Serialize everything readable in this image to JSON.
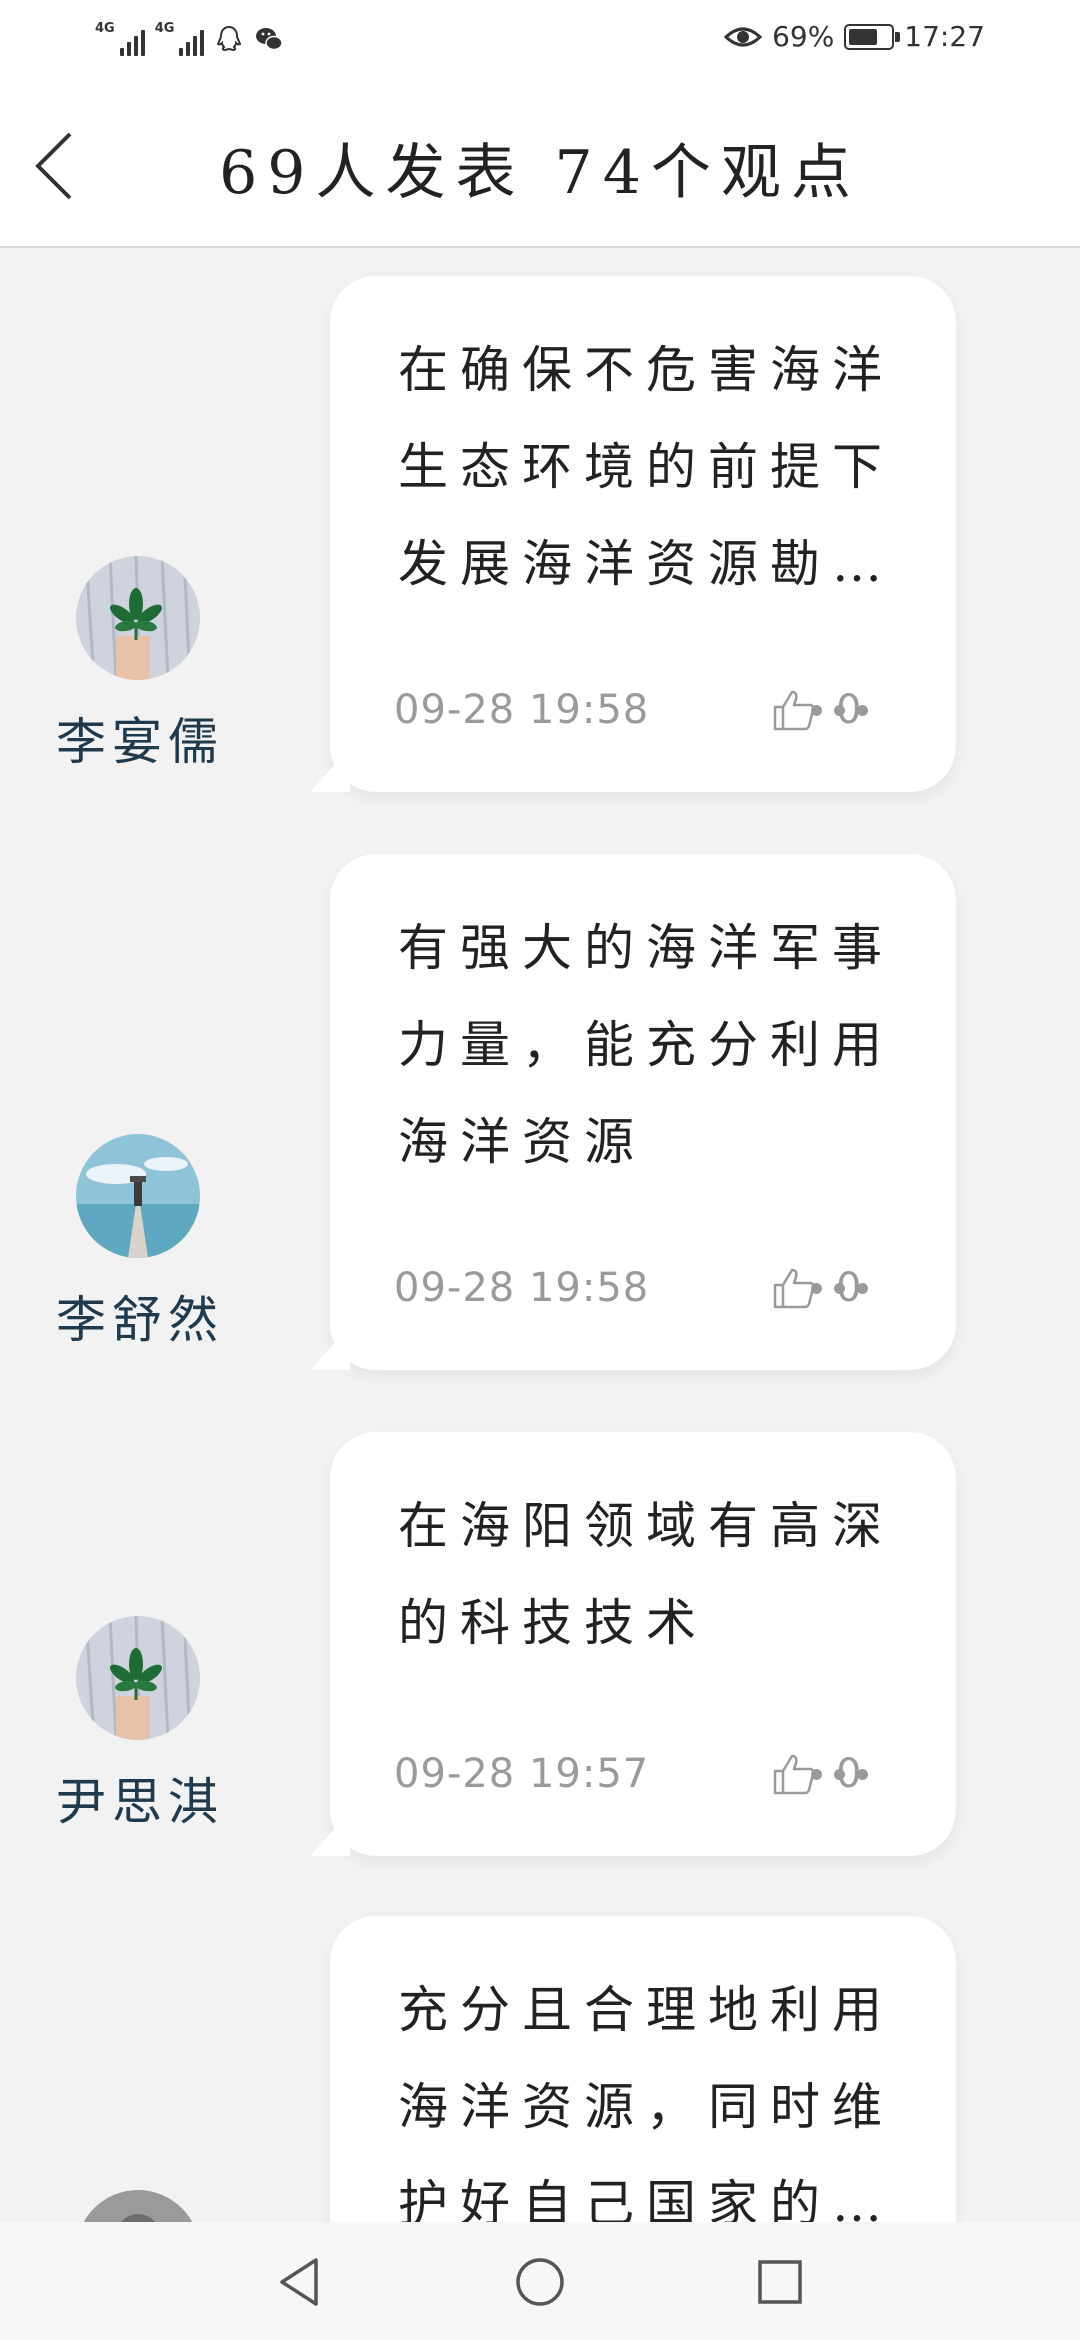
{
  "status_bar": {
    "network_1": "4G",
    "network_2": "4G",
    "battery_percent": "69%",
    "battery_level": 0.69,
    "time": "17:27",
    "icons": [
      "signal-icon",
      "signal-icon",
      "qq-icon",
      "wechat-icon",
      "eye-icon",
      "battery-icon"
    ]
  },
  "header": {
    "title": "69人发表 74个观点",
    "back_icon": "chevron-left-icon"
  },
  "posts": [
    {
      "author": "李宴儒",
      "avatar": "leaf-avatar",
      "content": "在确保不危害海洋生态环境的前提下发展海洋资源勘…",
      "time": "09-28 19:58",
      "likes": "0"
    },
    {
      "author": "李舒然",
      "avatar": "seaside-avatar",
      "content": "有强大的海洋军事力量，能充分利用海洋资源",
      "time": "09-28 19:58",
      "likes": "0"
    },
    {
      "author": "尹思淇",
      "avatar": "leaf-avatar",
      "content": "在海阳领域有高深的科技技术",
      "time": "09-28 19:57",
      "likes": "0"
    },
    {
      "author": "",
      "avatar": "gray-avatar",
      "content": "充分且合理地利用海洋资源，同时维护好自己国家的…",
      "time": "",
      "likes": ""
    }
  ],
  "nav_bar": {
    "buttons": [
      "back-triangle-icon",
      "home-circle-icon",
      "recents-square-icon"
    ]
  }
}
